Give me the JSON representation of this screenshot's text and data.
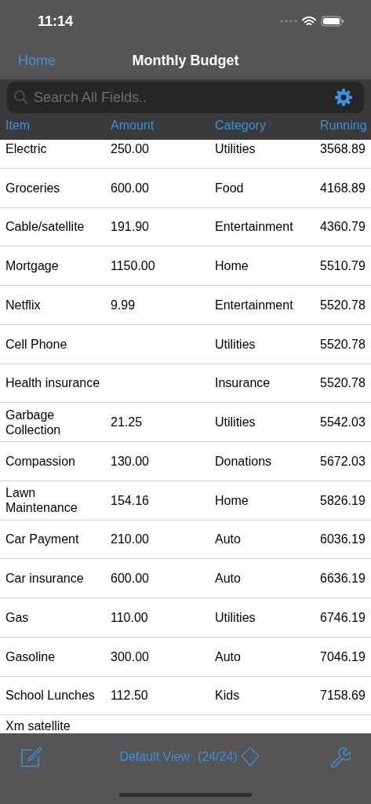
{
  "status_bar": {
    "time": "11:14"
  },
  "nav": {
    "back": "Home",
    "title": "Monthly Budget"
  },
  "search": {
    "placeholder": "Search All Fields.."
  },
  "table": {
    "columns": [
      "Item",
      "Amount",
      "Category",
      "Running"
    ],
    "rows": [
      {
        "item": "Electric",
        "amount": "250.00",
        "category": "Utilities",
        "running": "3568.89"
      },
      {
        "item": "Groceries",
        "amount": "600.00",
        "category": "Food",
        "running": "4168.89"
      },
      {
        "item": "Cable/satellite",
        "amount": "191.90",
        "category": "Entertainment",
        "running": "4360.79"
      },
      {
        "item": "Mortgage",
        "amount": "1150.00",
        "category": "Home",
        "running": "5510.79"
      },
      {
        "item": "Netflix",
        "amount": "9.99",
        "category": "Entertainment",
        "running": "5520.78"
      },
      {
        "item": "Cell Phone",
        "category": "Utilities",
        "running": "5520.78"
      },
      {
        "item": "Health insurance",
        "category": "Insurance",
        "running": "5520.78"
      },
      {
        "item": "Garbage Collection",
        "amount": "21.25",
        "category": "Utilities",
        "running": "5542.03"
      },
      {
        "item": "Compassion",
        "amount": "130.00",
        "category": "Donations",
        "running": "5672.03"
      },
      {
        "item": "Lawn Maintenance",
        "amount": "154.16",
        "category": "Home",
        "running": "5826.19"
      },
      {
        "item": "Car Payment",
        "amount": "210.00",
        "category": "Auto",
        "running": "6036.19"
      },
      {
        "item": "Car insurance",
        "amount": "600.00",
        "category": "Auto",
        "running": "6636.19"
      },
      {
        "item": "Gas",
        "amount": "110.00",
        "category": "Utilities",
        "running": "6746.19"
      },
      {
        "item": "Gasoline",
        "amount": "300.00",
        "category": "Auto",
        "running": "7046.19"
      },
      {
        "item": "School Lunches",
        "amount": "112.50",
        "category": "Kids",
        "running": "7158.69"
      },
      {
        "item": "Xm satellite",
        "partial": true
      }
    ]
  },
  "toolbar": {
    "view": "Default View",
    "count": "(24/24)"
  }
}
